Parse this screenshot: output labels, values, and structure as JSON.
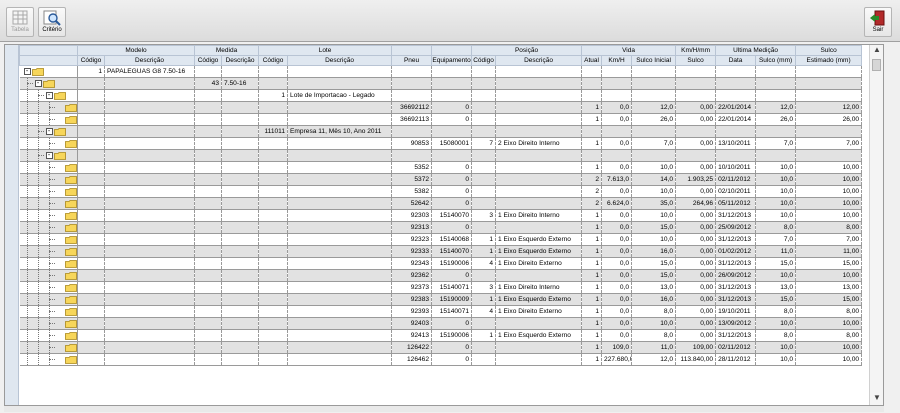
{
  "toolbar": {
    "tabela_label": "Tabela",
    "criterio_label": "Critério",
    "sair_label": "Sair"
  },
  "header_groups": [
    {
      "label": "",
      "span": 1
    },
    {
      "label": "Modelo",
      "span": 2
    },
    {
      "label": "Medida",
      "span": 2
    },
    {
      "label": "Lote",
      "span": 2
    },
    {
      "label": "",
      "span": 1
    },
    {
      "label": "",
      "span": 1
    },
    {
      "label": "Posição",
      "span": 2
    },
    {
      "label": "Vida",
      "span": 3
    },
    {
      "label": "Km/H/mm",
      "span": 1
    },
    {
      "label": "Ultima Medição",
      "span": 2
    },
    {
      "label": "Sulco",
      "span": 1
    }
  ],
  "columns": [
    "",
    "Código",
    "Descrição",
    "Código",
    "Descrição",
    "Código",
    "Descrição",
    "Pneu",
    "Equipamento",
    "Código",
    "Descrição",
    "Atual",
    "Km/H",
    "Sulco Inicial",
    "Sulco",
    "Data",
    "Sulco (mm)",
    "Estimado (mm)"
  ],
  "rows": [
    {
      "level": 0,
      "exp": "-",
      "c": [
        "1",
        "PAPALEGUAS G8 7.50-16",
        "",
        "",
        "",
        "",
        "",
        "",
        "",
        "",
        "",
        "",
        "",
        "",
        "",
        "",
        ""
      ]
    },
    {
      "level": 1,
      "exp": "-",
      "c": [
        "",
        "",
        "43",
        "7.50-16",
        "",
        "",
        "",
        "",
        "",
        "",
        "",
        "",
        "",
        "",
        "",
        "",
        ""
      ]
    },
    {
      "level": 2,
      "exp": "-",
      "c": [
        "",
        "",
        "",
        "",
        "1",
        "Lote de Importacao - Legado",
        "",
        "",
        "",
        "",
        "",
        "",
        "",
        "",
        "",
        "",
        ""
      ]
    },
    {
      "level": 3,
      "exp": "",
      "c": [
        "",
        "",
        "",
        "",
        "",
        "",
        "36692112",
        "0",
        "",
        "",
        "1",
        "0,0",
        "12,0",
        "0,00",
        "22/01/2014",
        "12,0",
        "12,00"
      ]
    },
    {
      "level": 3,
      "exp": "",
      "c": [
        "",
        "",
        "",
        "",
        "",
        "",
        "36692113",
        "0",
        "",
        "",
        "1",
        "0,0",
        "26,0",
        "0,00",
        "22/01/2014",
        "26,0",
        "26,00"
      ]
    },
    {
      "level": 2,
      "exp": "-",
      "c": [
        "",
        "",
        "",
        "",
        "111011",
        "Empresa 11, Mês 10, Ano 2011",
        "",
        "",
        "",
        "",
        "",
        "",
        "",
        "",
        "",
        "",
        ""
      ]
    },
    {
      "level": 3,
      "exp": "",
      "c": [
        "",
        "",
        "",
        "",
        "",
        "",
        "90853",
        "15080001",
        "7",
        "2 Eixo Direito Interno",
        "1",
        "0,0",
        "7,0",
        "0,00",
        "13/10/2011",
        "7,0",
        "7,00"
      ]
    },
    {
      "level": 2,
      "exp": "-",
      "c": [
        "",
        "",
        "",
        "",
        "",
        "",
        "",
        "",
        "",
        "",
        "",
        "",
        "",
        "",
        "",
        "",
        ""
      ]
    },
    {
      "level": 3,
      "exp": "",
      "c": [
        "",
        "",
        "",
        "",
        "",
        "",
        "5352",
        "0",
        "",
        "",
        "1",
        "0,0",
        "10,0",
        "0,00",
        "10/10/2011",
        "10,0",
        "10,00"
      ]
    },
    {
      "level": 3,
      "exp": "",
      "c": [
        "",
        "",
        "",
        "",
        "",
        "",
        "5372",
        "0",
        "",
        "",
        "2",
        "7.613,0",
        "14,0",
        "1.903,25",
        "02/11/2012",
        "10,0",
        "10,00"
      ]
    },
    {
      "level": 3,
      "exp": "",
      "c": [
        "",
        "",
        "",
        "",
        "",
        "",
        "5382",
        "0",
        "",
        "",
        "2",
        "0,0",
        "10,0",
        "0,00",
        "02/10/2011",
        "10,0",
        "10,00"
      ]
    },
    {
      "level": 3,
      "exp": "",
      "c": [
        "",
        "",
        "",
        "",
        "",
        "",
        "52642",
        "0",
        "",
        "",
        "2",
        "6.624,0",
        "35,0",
        "264,96",
        "05/11/2012",
        "10,0",
        "10,00"
      ]
    },
    {
      "level": 3,
      "exp": "",
      "c": [
        "",
        "",
        "",
        "",
        "",
        "",
        "92303",
        "15140070",
        "3",
        "1 Eixo Direito Interno",
        "1",
        "0,0",
        "10,0",
        "0,00",
        "31/12/2013",
        "10,0",
        "10,00"
      ]
    },
    {
      "level": 3,
      "exp": "",
      "c": [
        "",
        "",
        "",
        "",
        "",
        "",
        "92313",
        "0",
        "",
        "",
        "1",
        "0,0",
        "15,0",
        "0,00",
        "25/09/2012",
        "8,0",
        "8,00"
      ]
    },
    {
      "level": 3,
      "exp": "",
      "c": [
        "",
        "",
        "",
        "",
        "",
        "",
        "92323",
        "15140068",
        "1",
        "1 Eixo Esquerdo Externo",
        "1",
        "0,0",
        "10,0",
        "0,00",
        "31/12/2013",
        "7,0",
        "7,00"
      ]
    },
    {
      "level": 3,
      "exp": "",
      "c": [
        "",
        "",
        "",
        "",
        "",
        "",
        "92333",
        "15140070",
        "1",
        "1 Eixo Esquerdo Externo",
        "1",
        "0,0",
        "16,0",
        "0,00",
        "01/02/2012",
        "11,0",
        "11,00"
      ]
    },
    {
      "level": 3,
      "exp": "",
      "c": [
        "",
        "",
        "",
        "",
        "",
        "",
        "92343",
        "15190006",
        "4",
        "1 Eixo Direito Externo",
        "1",
        "0,0",
        "15,0",
        "0,00",
        "31/12/2013",
        "15,0",
        "15,00"
      ]
    },
    {
      "level": 3,
      "exp": "",
      "c": [
        "",
        "",
        "",
        "",
        "",
        "",
        "92362",
        "0",
        "",
        "",
        "1",
        "0,0",
        "15,0",
        "0,00",
        "26/09/2012",
        "10,0",
        "10,00"
      ]
    },
    {
      "level": 3,
      "exp": "",
      "c": [
        "",
        "",
        "",
        "",
        "",
        "",
        "92373",
        "15140071",
        "3",
        "1 Eixo Direito Interno",
        "1",
        "0,0",
        "13,0",
        "0,00",
        "31/12/2013",
        "13,0",
        "13,00"
      ]
    },
    {
      "level": 3,
      "exp": "",
      "c": [
        "",
        "",
        "",
        "",
        "",
        "",
        "92383",
        "15190009",
        "1",
        "1 Eixo Esquerdo Externo",
        "1",
        "0,0",
        "16,0",
        "0,00",
        "31/12/2013",
        "15,0",
        "15,00"
      ]
    },
    {
      "level": 3,
      "exp": "",
      "c": [
        "",
        "",
        "",
        "",
        "",
        "",
        "92393",
        "15140071",
        "4",
        "1 Eixo Direito Externo",
        "1",
        "0,0",
        "8,0",
        "0,00",
        "19/10/2011",
        "8,0",
        "8,00"
      ]
    },
    {
      "level": 3,
      "exp": "",
      "c": [
        "",
        "",
        "",
        "",
        "",
        "",
        "92403",
        "0",
        "",
        "",
        "1",
        "0,0",
        "10,0",
        "0,00",
        "13/09/2012",
        "10,0",
        "10,00"
      ]
    },
    {
      "level": 3,
      "exp": "",
      "c": [
        "",
        "",
        "",
        "",
        "",
        "",
        "92413",
        "15190006",
        "1",
        "1 Eixo Esquerdo Externo",
        "1",
        "0,0",
        "8,0",
        "0,00",
        "31/12/2013",
        "8,0",
        "8,00"
      ]
    },
    {
      "level": 3,
      "exp": "",
      "c": [
        "",
        "",
        "",
        "",
        "",
        "",
        "126422",
        "0",
        "",
        "",
        "1",
        "109,0",
        "11,0",
        "109,00",
        "02/11/2012",
        "10,0",
        "10,00"
      ]
    },
    {
      "level": 3,
      "exp": "",
      "c": [
        "",
        "",
        "",
        "",
        "",
        "",
        "126462",
        "0",
        "",
        "",
        "1",
        "227.680,0",
        "12,0",
        "113.840,00",
        "28/11/2012",
        "10,0",
        "10,00"
      ]
    }
  ]
}
